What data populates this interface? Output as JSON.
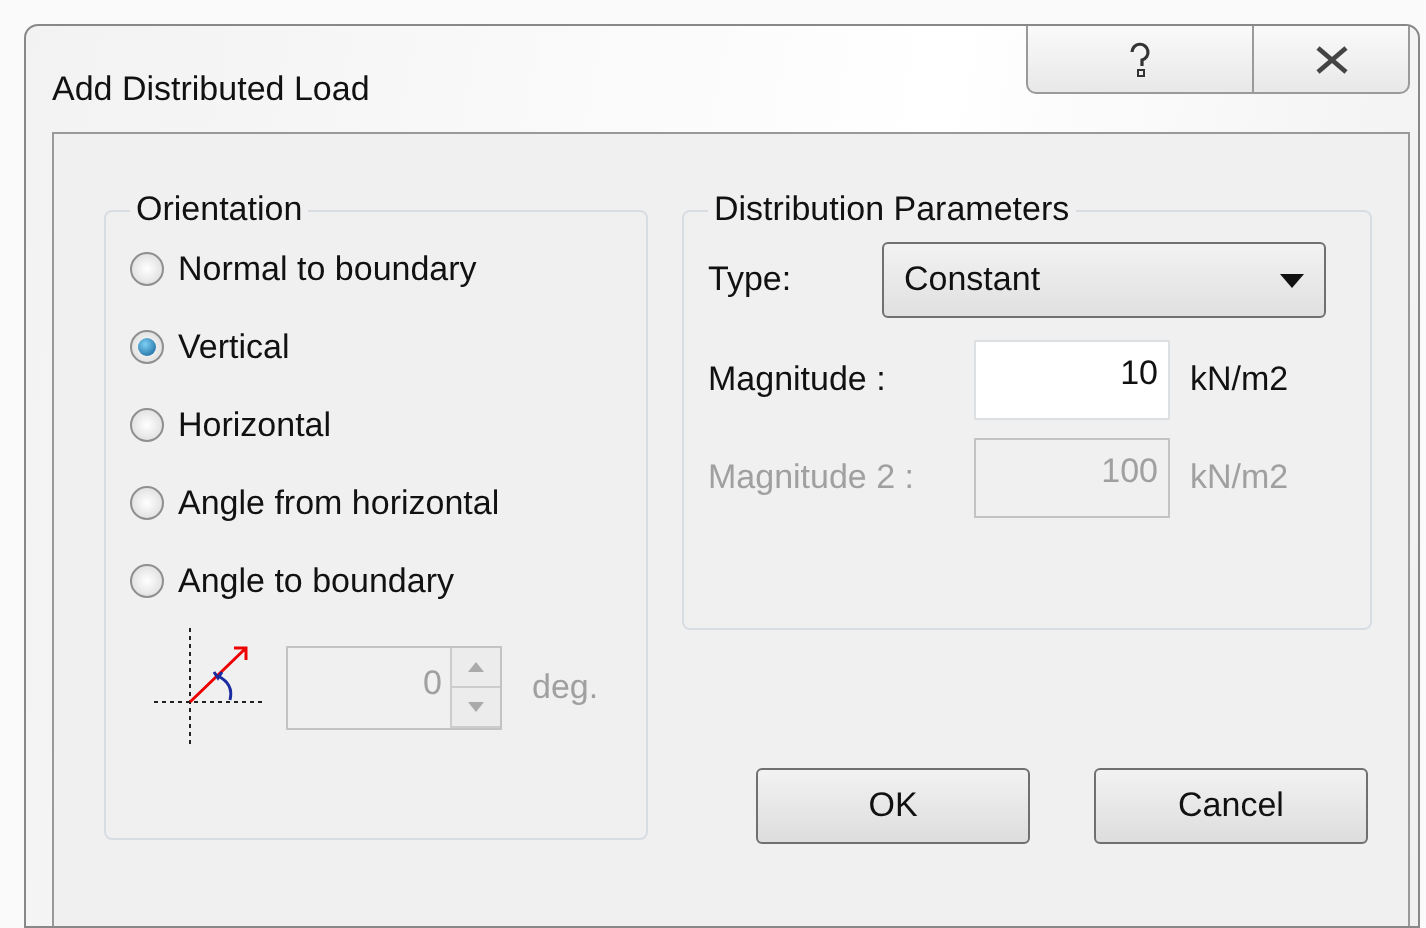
{
  "window": {
    "title": "Add Distributed Load"
  },
  "orientation": {
    "legend": "Orientation",
    "options": [
      {
        "label": "Normal to boundary",
        "selected": false
      },
      {
        "label": "Vertical",
        "selected": true
      },
      {
        "label": "Horizontal",
        "selected": false
      },
      {
        "label": "Angle from horizontal",
        "selected": false
      },
      {
        "label": "Angle to boundary",
        "selected": false
      }
    ],
    "angle": {
      "value": "0",
      "unit": "deg.",
      "disabled": true
    }
  },
  "distribution": {
    "legend": "Distribution Parameters",
    "type_label": "Type:",
    "type_value": "Constant",
    "fields": [
      {
        "label": "Magnitude :",
        "value": "10",
        "unit": "kN/m2",
        "disabled": false
      },
      {
        "label": "Magnitude 2 :",
        "value": "100",
        "unit": "kN/m2",
        "disabled": true
      }
    ]
  },
  "buttons": [
    "OK",
    "Cancel"
  ]
}
